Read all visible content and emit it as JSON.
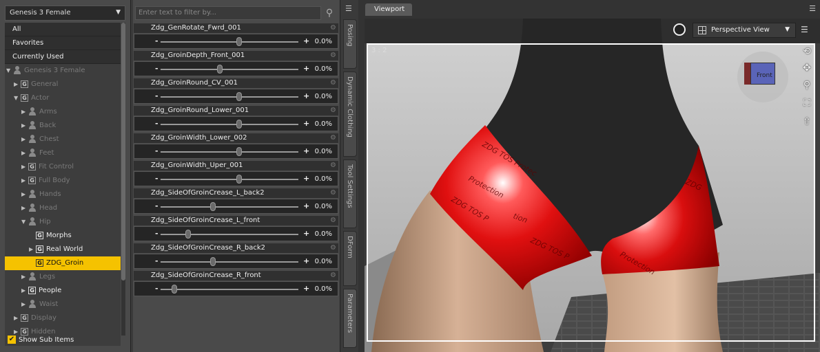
{
  "left_panel": {
    "figure_select": "Genesis 3 Female",
    "fixed_items": [
      "All",
      "Favorites",
      "Currently Used"
    ],
    "tree": [
      {
        "label": "Genesis 3 Female",
        "indent": 0,
        "twisty": "▼",
        "icon": "figure",
        "active": false
      },
      {
        "label": "General",
        "indent": 1,
        "twisty": "▶",
        "icon": "G",
        "active": false
      },
      {
        "label": "Actor",
        "indent": 1,
        "twisty": "▼",
        "icon": "G",
        "active": false
      },
      {
        "label": "Arms",
        "indent": 2,
        "twisty": "▶",
        "icon": "person",
        "active": false
      },
      {
        "label": "Back",
        "indent": 2,
        "twisty": "▶",
        "icon": "person",
        "active": false
      },
      {
        "label": "Chest",
        "indent": 2,
        "twisty": "▶",
        "icon": "person",
        "active": false
      },
      {
        "label": "Feet",
        "indent": 2,
        "twisty": "▶",
        "icon": "person",
        "active": false
      },
      {
        "label": "Fit Control",
        "indent": 2,
        "twisty": "▶",
        "icon": "G",
        "active": false
      },
      {
        "label": "Full Body",
        "indent": 2,
        "twisty": "▶",
        "icon": "G",
        "active": false
      },
      {
        "label": "Hands",
        "indent": 2,
        "twisty": "▶",
        "icon": "person",
        "active": false
      },
      {
        "label": "Head",
        "indent": 2,
        "twisty": "▶",
        "icon": "person",
        "active": false
      },
      {
        "label": "Hip",
        "indent": 2,
        "twisty": "▼",
        "icon": "person",
        "active": false
      },
      {
        "label": "Morphs",
        "indent": 3,
        "twisty": "",
        "icon": "G",
        "active": true
      },
      {
        "label": "Real World",
        "indent": 3,
        "twisty": "▶",
        "icon": "G",
        "active": true
      },
      {
        "label": "ZDG_Groin",
        "indent": 3,
        "twisty": "",
        "icon": "G",
        "active": true,
        "selected": true
      },
      {
        "label": "Legs",
        "indent": 2,
        "twisty": "▶",
        "icon": "person",
        "active": false
      },
      {
        "label": "People",
        "indent": 2,
        "twisty": "▶",
        "icon": "G",
        "active": true
      },
      {
        "label": "Waist",
        "indent": 2,
        "twisty": "▶",
        "icon": "person",
        "active": false
      },
      {
        "label": "Display",
        "indent": 1,
        "twisty": "▶",
        "icon": "G",
        "active": false
      },
      {
        "label": "Hidden",
        "indent": 1,
        "twisty": "▶",
        "icon": "G",
        "active": false
      }
    ],
    "show_sub_items": "Show Sub Items",
    "show_sub_items_checked": true
  },
  "params_panel": {
    "filter_placeholder": "Enter text to filter by...",
    "params": [
      {
        "name": "Zdg_GenRotate_Fwrd_001",
        "value": "0.0%",
        "knob": 0.57
      },
      {
        "name": "Zdg_GroinDepth_Front_001",
        "value": "0.0%",
        "knob": 0.43
      },
      {
        "name": "Zdg_GroinRound_CV_001",
        "value": "0.0%",
        "knob": 0.57
      },
      {
        "name": "Zdg_GroinRound_Lower_001",
        "value": "0.0%",
        "knob": 0.57
      },
      {
        "name": "Zdg_GroinWidth_Lower_002",
        "value": "0.0%",
        "knob": 0.57
      },
      {
        "name": "Zdg_GroinWidth_Uper_001",
        "value": "0.0%",
        "knob": 0.57
      },
      {
        "name": "Zdg_SideOfGroinCrease_L_back2",
        "value": "0.0%",
        "knob": 0.38
      },
      {
        "name": "Zdg_SideOfGroinCrease_L_front",
        "value": "0.0%",
        "knob": 0.2
      },
      {
        "name": "Zdg_SideOfGroinCrease_R_back2",
        "value": "0.0%",
        "knob": 0.38
      },
      {
        "name": "Zdg_SideOfGroinCrease_R_front",
        "value": "0.0%",
        "knob": 0.1
      }
    ]
  },
  "side_tabs": [
    "Posing",
    "Dynamic Clothing",
    "Tool Settings",
    "DForm",
    "Parameters"
  ],
  "viewport": {
    "tab": "Viewport",
    "view_select": "Perspective View",
    "ratio": "3 : 2",
    "cube_label": "Front",
    "texture_text": [
      "ZDG TOS P",
      "Protection",
      "ZDG TOS Protec",
      "ZDG",
      "tion",
      "ZDG TOS P",
      "Protection"
    ]
  },
  "colors": {
    "accent": "#f5c200",
    "panel": "#4a4a4a",
    "shorts": "#d41010"
  }
}
